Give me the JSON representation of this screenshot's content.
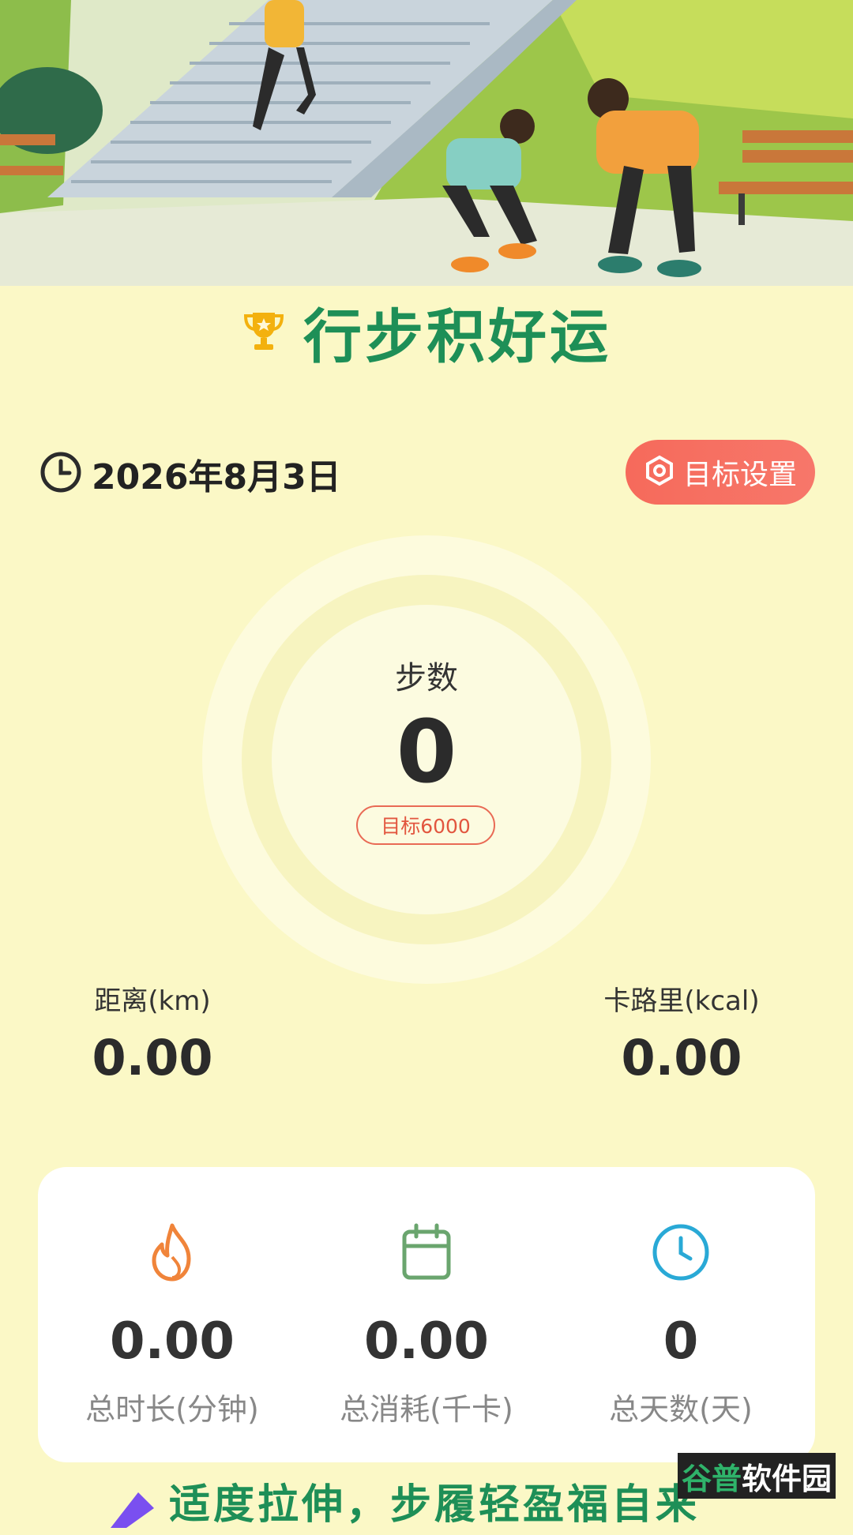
{
  "header": {
    "title": "行步积好运"
  },
  "date": {
    "text": "2026年8月3日"
  },
  "goal_button": {
    "label": "目标设置"
  },
  "steps": {
    "label": "步数",
    "value": "0",
    "goal": "目标6000"
  },
  "metrics": [
    {
      "label": "距离(km)",
      "value": "0.00"
    },
    {
      "label": "卡路里(kcal)",
      "value": "0.00"
    }
  ],
  "stats": [
    {
      "icon": "flame-icon",
      "value": "0.00",
      "label": "总时长(分钟)"
    },
    {
      "icon": "calendar-icon",
      "value": "0.00",
      "label": "总消耗(千卡)"
    },
    {
      "icon": "clock-icon",
      "value": "0",
      "label": "总天数(天)"
    }
  ],
  "banner": {
    "text": "适度拉伸，步履轻盈福自来"
  },
  "watermark": {
    "part1": "谷普",
    "part2": "软件园"
  },
  "colors": {
    "accent_green": "#1e8f57",
    "goal_red": "#f66a5b",
    "background": "#fbf8c6"
  }
}
